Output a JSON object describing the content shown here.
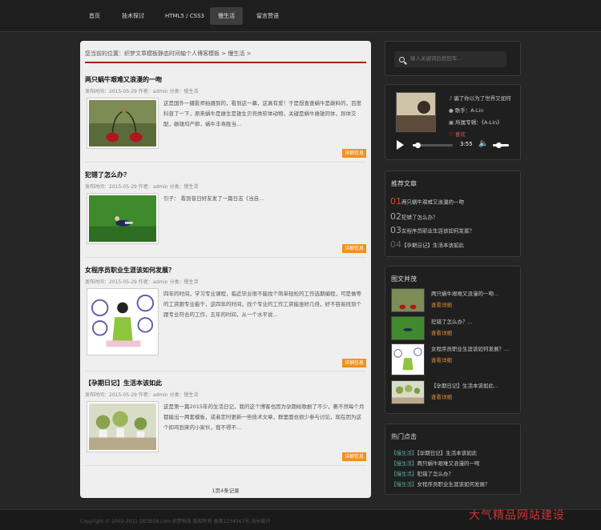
{
  "nav": [
    {
      "label": "首页"
    },
    {
      "label": "技术探讨"
    },
    {
      "label": "HTML5 / CSS3"
    },
    {
      "label": "慢生活",
      "active": true
    },
    {
      "label": "留言赞语"
    }
  ],
  "breadcrumb": {
    "prefix": "您当前的位置：",
    "home": "织梦文章模板静态时间轴个人博客模板",
    "sep": ">",
    "current": "慢生活",
    "trail": ">"
  },
  "posts": [
    {
      "title": "两只蜗牛艰难又浪漫的一吻",
      "meta": "发布时间：2015-05-29  作者：admin  分类：慢生活",
      "excerpt": "这是国外一摄影师拍摄到的，看到这一幕，这真有爱！于是想查查蜗牛是雌料的，百度科普了一下，原来蜗牛是雌生是雄生贝壳类软体动物，关键是蜗牛雌雄同体，异体交配，雌雄均产卵，蜗牛丰寿胜当...",
      "more": "详细信息"
    },
    {
      "title": "犯错了怎么办？",
      "meta": "发布时间：2015-05-29  作者：admin  分类：慢生活",
      "excerpt": "引子：  看到昔日好友发了一篇日志《当自...",
      "more": "详细信息"
    },
    {
      "title": "女程序员职业生涯该如何发展？",
      "meta": "发布时间：2015-05-29  作者：admin  分类：慢生活",
      "excerpt": "四年的时间，学习专业课程，临近毕业很不能找个简单轻松的工作选期编程，可是做等的工资跟专业能干，这四年的时间，找个专业的工作工资能虽好几倍，好不容易找到个跟专业符合的工作，五年的时间，从一个水平说...",
      "more": "详细信息"
    },
    {
      "title": "【孕期日记】生活本该如此",
      "meta": "发布时间：2015-05-29  作者：admin  分类：慢生活",
      "excerpt": "这是第一篇2015年的生活日记，我的这个博客也因为孕期给歌剧了不少，裹不然每个月都能出一两套模板，或者定时更新一些技术文章，群里面也很少参与讨论，现在因为这个抑鸡到来的小家伙，我不得不...",
      "more": "详细信息"
    }
  ],
  "pager": "1页4条记录",
  "search": {
    "placeholder": "输入关键词后按回车..."
  },
  "music": {
    "song": "骗了你以为了世界又如何",
    "singer": "歌手：A-Lin",
    "album": "所属专辑：《A-Lin》",
    "like": "喜欢",
    "time": "3:55",
    "progress": 0.55
  },
  "recommend": {
    "title": "推荐文章",
    "items": [
      {
        "num": "01",
        "text": "两只蜗牛艰难又浪漫的一吻"
      },
      {
        "num": "02",
        "text": "犯错了怎么办？"
      },
      {
        "num": "03",
        "text": "女程序员职业生涯该如何发展？"
      },
      {
        "num": "04",
        "text": "【孕期日记】生活本该如此"
      }
    ]
  },
  "twlist": {
    "title": "图文并茂",
    "items": [
      {
        "text": "两只蜗牛艰难又浪漫的一吻...",
        "more": "查看详细"
      },
      {
        "text": "犯错了怎么办？...",
        "more": "查看详细"
      },
      {
        "text": "女程序员职业生涯该如何发展？...",
        "more": "查看详细"
      },
      {
        "text": "【孕期日记】生活本该如此...",
        "more": "查看详细"
      }
    ]
  },
  "hot": {
    "title": "热门点击",
    "items": [
      {
        "tag": "【慢生活】",
        "text": "【孕期日记】生活本该如此"
      },
      {
        "tag": "【慢生活】",
        "text": "两只蜗牛艰难又浪漫的一吻"
      },
      {
        "tag": "【慢生活】",
        "text": "犯错了怎么办？"
      },
      {
        "tag": "【慢生活】",
        "text": "女程序员职业生涯该如何发展？"
      }
    ]
  },
  "footer": {
    "copy": "Copyright © 2002-2011 DEDE58.com 织梦科技 版权所有 备案1234567号 站长统计"
  },
  "watermark": "大气精品网站建设"
}
